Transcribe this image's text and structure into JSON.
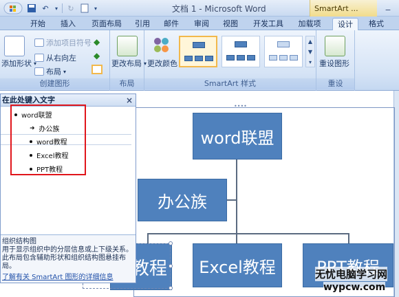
{
  "window": {
    "doc_title": "文档 1 - Microsoft Word",
    "context_title": "SmartArt ..."
  },
  "tabs": [
    "开始",
    "插入",
    "页面布局",
    "引用",
    "邮件",
    "审阅",
    "视图",
    "开发工具",
    "加载项",
    "设计",
    "格式"
  ],
  "active_tab": "设计",
  "ribbon": {
    "create_graphic": {
      "label": "创建图形",
      "add_shape": "添加形状",
      "add_bullet": "添加项目符号",
      "right_to_left": "从右向左",
      "layout": "布局"
    },
    "layouts": {
      "label": "布局",
      "change_layout": "更改布局"
    },
    "styles": {
      "label": "SmartArt 样式",
      "change_colors": "更改颜色"
    },
    "reset": {
      "label": "重设",
      "reset_graphic": "重设图形"
    }
  },
  "text_pane": {
    "title": "在此处键入文字",
    "items": [
      {
        "text": "word联盟",
        "level": 0,
        "marker": "bullet"
      },
      {
        "text": "办公族",
        "level": 1,
        "marker": "arrow"
      },
      {
        "text": "word教程",
        "level": 1,
        "marker": "bullet"
      },
      {
        "text": "Excel教程",
        "level": 1,
        "marker": "bullet"
      },
      {
        "text": "PPT教程",
        "level": 1,
        "marker": "bullet"
      }
    ],
    "desc_title": "组织结构图",
    "desc_body": "用于显示组织中的分层信息或上下级关系。此布局包含辅助形状和组织结构图悬挂布局。",
    "link": "了解有关 SmartArt 图形的详细信息"
  },
  "diagram": {
    "root": "word联盟",
    "assistant": "办公族",
    "children": [
      "教程",
      "Excel教程",
      "PPT教程"
    ]
  },
  "watermark": {
    "line1": "无忧电脑学习网",
    "line2": "wypcw.com"
  },
  "colors": {
    "node_fill": "#4f81bd",
    "highlight": "#e0141a",
    "ribbon": "#d6e4f6"
  }
}
